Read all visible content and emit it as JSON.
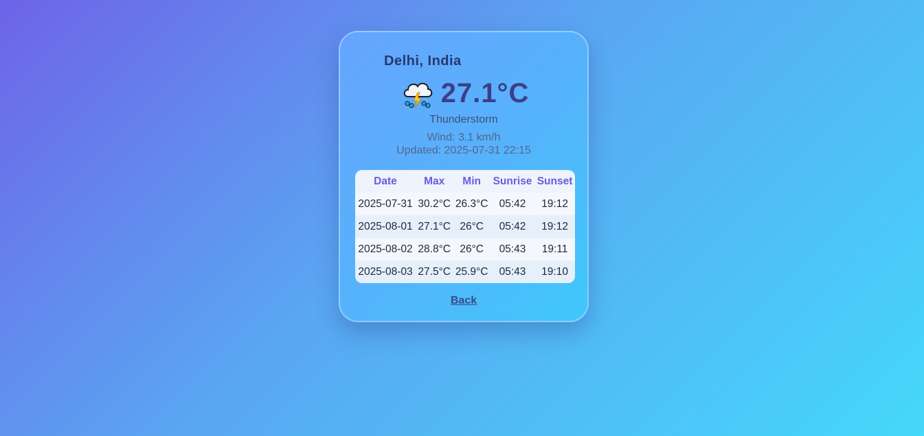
{
  "location": "Delhi, India",
  "current": {
    "icon": "thunderstorm-icon",
    "temperature": "27.1°C",
    "condition": "Thunderstorm",
    "wind": "Wind: 3.1 km/h",
    "updated": "Updated: 2025-07-31 22:15"
  },
  "forecast": {
    "headers": [
      "Date",
      "Max",
      "Min",
      "Sunrise",
      "Sunset"
    ],
    "rows": [
      [
        "2025-07-31",
        "30.2°C",
        "26.3°C",
        "05:42",
        "19:12"
      ],
      [
        "2025-08-01",
        "27.1°C",
        "26°C",
        "05:42",
        "19:12"
      ],
      [
        "2025-08-02",
        "28.8°C",
        "26°C",
        "05:43",
        "19:11"
      ],
      [
        "2025-08-03",
        "27.5°C",
        "25.9°C",
        "05:43",
        "19:10"
      ]
    ]
  },
  "back_label": "Back",
  "colors": {
    "accent": "#6a5bdb",
    "title": "#27386d",
    "temperature": "#3b3f87"
  }
}
